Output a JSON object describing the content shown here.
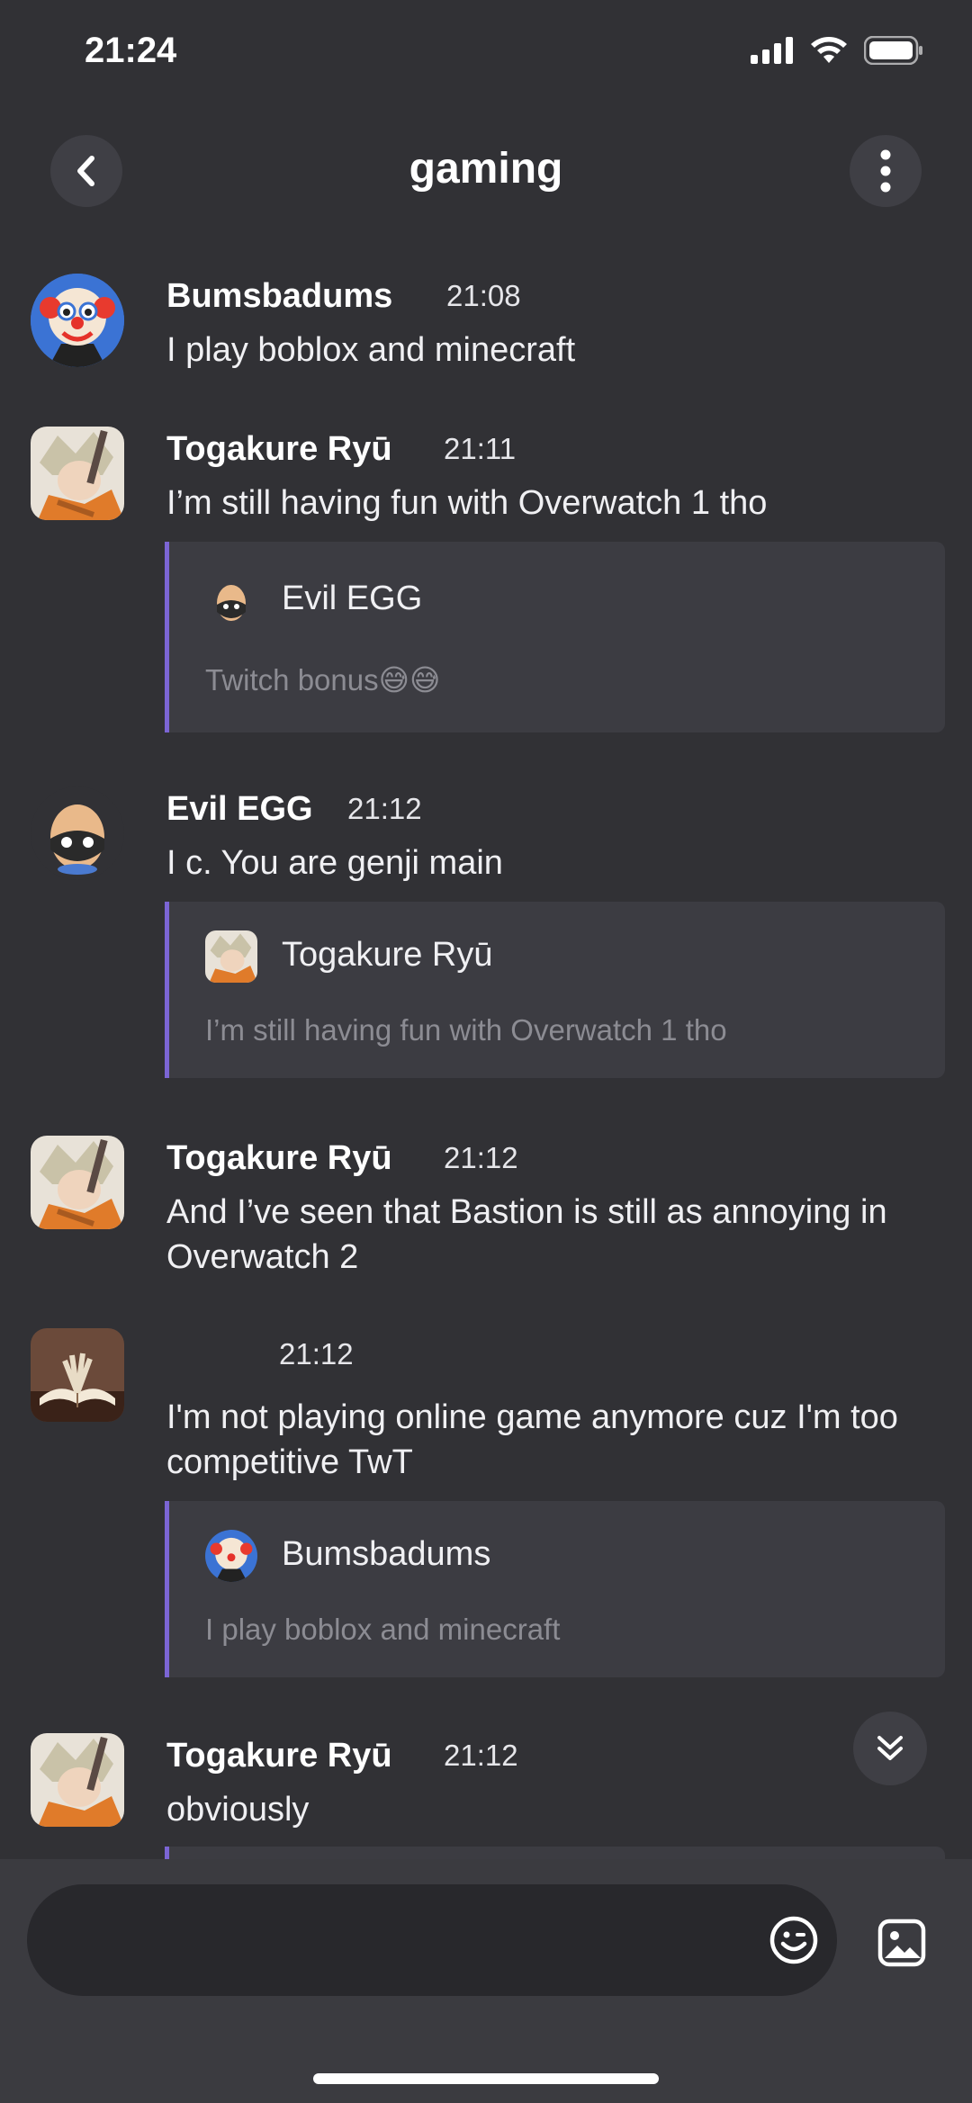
{
  "status": {
    "time": "21:24"
  },
  "header": {
    "title": "gaming",
    "back_icon": "chevron-left-icon",
    "more_icon": "vertical-dots-icon"
  },
  "messages": [
    {
      "author": "Bumsbadums",
      "time": "21:08",
      "text": "I play boblox and minecraft",
      "avatar": "clown-avatar"
    },
    {
      "author": "Togakure Ryū",
      "time": "21:11",
      "text": "I’m still having fun with Overwatch 1 tho",
      "quote": {
        "author": "Evil EGG",
        "text": "Twitch bonus😅😅"
      }
    },
    {
      "author": "Evil EGG",
      "time": "21:12",
      "text": "I c. You are genji main",
      "quote": {
        "author": "Togakure Ryū",
        "text": "I’m still having fun with Overwatch 1 tho"
      }
    },
    {
      "author": "Togakure Ryū",
      "time": "21:12",
      "text": "And I’ve seen that Bastion is still as annoying in Overwatch 2"
    },
    {
      "author": "",
      "time": "21:12",
      "text": "I'm not playing online game anymore cuz I'm too competitive TwT",
      "quote": {
        "author": "Bumsbadums",
        "text": "I play boblox and minecraft"
      }
    },
    {
      "author": "Togakure Ryū",
      "time": "21:12",
      "text": "obviously"
    }
  ],
  "composer": {
    "placeholder": "",
    "emoji_icon": "smiley-icon",
    "image_icon": "image-icon"
  },
  "jump_icon": "double-chevron-down-icon",
  "colors": {
    "background": "#313135",
    "quote_accent": "#7b65d4",
    "quote_bg": "#3c3c42",
    "input_bg": "#28282c"
  }
}
